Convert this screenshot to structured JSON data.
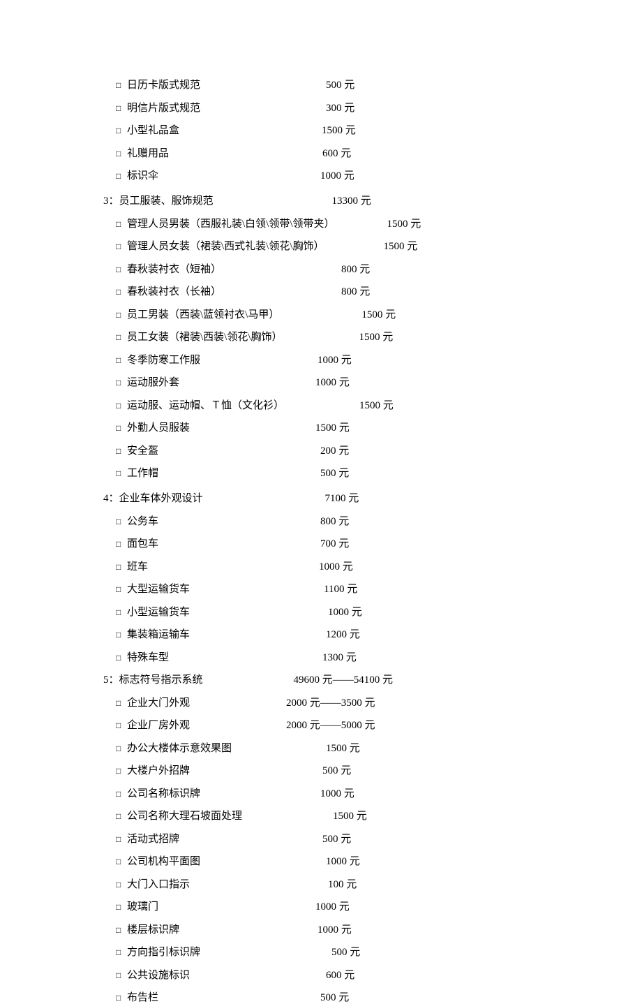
{
  "glyphs": {
    "box": "□",
    "yuan": "元",
    "dash": "——",
    "colon": "："
  },
  "groups": [
    {
      "type": "items",
      "items": [
        {
          "label": "日历卡版式规范",
          "price": "500",
          "gap": 180
        },
        {
          "label": "明信片版式规范",
          "price": "300",
          "gap": 180
        },
        {
          "label": "小型礼品盒",
          "price": "1500",
          "gap": 204
        },
        {
          "label": "礼赠用品",
          "price": "600",
          "gap": 220
        },
        {
          "label": "标识伞",
          "price": "1000",
          "gap": 232
        }
      ]
    },
    {
      "type": "heading",
      "num": "3",
      "label": "员工服装、服饰规范",
      "price": "13300",
      "gap": 170
    },
    {
      "type": "items",
      "items": [
        {
          "label": "管理人员男装（西服礼装\\白领\\领带\\领带夹）",
          "price": "1500",
          "gap": 75
        },
        {
          "label": "管理人员女装（裙装\\西式礼装\\领花\\胸饰）",
          "price": "1500",
          "gap": 85
        },
        {
          "label": "春秋装衬衣（短袖）",
          "price": "800",
          "gap": 172
        },
        {
          "label": "春秋装衬衣（长袖）",
          "price": "800",
          "gap": 172
        },
        {
          "label": "员工男装（西装\\蓝领衬衣\\马甲）",
          "price": "1500",
          "gap": 118
        },
        {
          "label": "员工女装（裙装\\西装\\领花\\胸饰）",
          "price": "1500",
          "gap": 110
        },
        {
          "label": "冬季防寒工作服",
          "price": "1000",
          "gap": 168
        },
        {
          "label": "运动服外套",
          "price": "1000",
          "gap": 195
        },
        {
          "label": "运动服、运动帽、Ｔ恤（文化衫）",
          "price": "1500",
          "gap": 108
        },
        {
          "label": "外勤人员服装",
          "price": "1500",
          "gap": 180
        },
        {
          "label": "安全盔",
          "price": "200",
          "gap": 232
        },
        {
          "label": "工作帽",
          "price": "500",
          "gap": 232
        }
      ]
    },
    {
      "type": "heading",
      "num": "4",
      "label": "企业车体外观设计",
      "price": "7100",
      "gap": 175
    },
    {
      "type": "items",
      "items": [
        {
          "label": "公务车",
          "price": "800",
          "gap": 232
        },
        {
          "label": "面包车",
          "price": "700",
          "gap": 232
        },
        {
          "label": "班车",
          "price": "1000",
          "gap": 245
        },
        {
          "label": "大型运输货车",
          "price": "1100",
          "gap": 192
        },
        {
          "label": "小型运输货车",
          "price": "1000",
          "gap": 198
        },
        {
          "label": "集装箱运输车",
          "price": "1200",
          "gap": 195
        },
        {
          "label": "特殊车型",
          "price": "1300",
          "gap": 220
        }
      ]
    },
    {
      "type": "heading",
      "num": "5",
      "label": "标志符号指示系统",
      "price_range": [
        "49600",
        "54100"
      ],
      "gap": 130,
      "tight": true
    },
    {
      "type": "items",
      "items": [
        {
          "label": "企业大门外观",
          "price_range": [
            "2000",
            "3500"
          ],
          "gap": 138
        },
        {
          "label": "企业厂房外观",
          "price_range": [
            "2000",
            "5000"
          ],
          "gap": 138
        },
        {
          "label": "办公大楼体示意效果图",
          "price": "1500",
          "gap": 135
        },
        {
          "label": "大楼户外招牌",
          "price": "500",
          "gap": 190
        },
        {
          "label": "公司名称标识牌",
          "price": "1000",
          "gap": 172
        },
        {
          "label": "公司名称大理石坡面处理",
          "price": "1500",
          "gap": 130
        },
        {
          "label": "活动式招牌",
          "price": "500",
          "gap": 205
        },
        {
          "label": "公司机构平面图",
          "price": "1000",
          "gap": 180
        },
        {
          "label": "大门入口指示",
          "price": "100",
          "gap": 198
        },
        {
          "label": "玻璃门",
          "price": "1000",
          "gap": 225
        },
        {
          "label": "楼层标识牌",
          "price": "1000",
          "gap": 198
        },
        {
          "label": "方向指引标识牌",
          "price": "500",
          "gap": 188
        },
        {
          "label": "公共设施标识",
          "price": "600",
          "gap": 195
        },
        {
          "label": "布告栏",
          "price": "500",
          "gap": 232
        }
      ]
    }
  ]
}
